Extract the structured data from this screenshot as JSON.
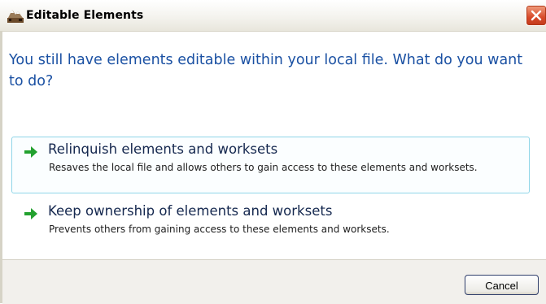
{
  "window": {
    "title": "Editable Elements",
    "app_icon": "app-logo-icon",
    "close_icon": "close-icon"
  },
  "main": {
    "instruction": "You still have elements editable within your local file. What do you want to do?",
    "options": [
      {
        "title": "Relinquish elements and worksets",
        "description": "Resaves the local file and allows others to gain access to these elements and worksets.",
        "icon": "green-arrow-right-icon",
        "selected": true
      },
      {
        "title": "Keep ownership of elements and worksets",
        "description": "Prevents others from gaining access to these elements and worksets.",
        "icon": "green-arrow-right-icon",
        "selected": false
      }
    ]
  },
  "footer": {
    "cancel_label": "Cancel"
  },
  "colors": {
    "instruction_text": "#1b51a3",
    "link_title_text": "#15284f",
    "arrow_green": "#23a12f",
    "selected_border": "#8fd5e8",
    "close_red": "#d84a2a"
  }
}
